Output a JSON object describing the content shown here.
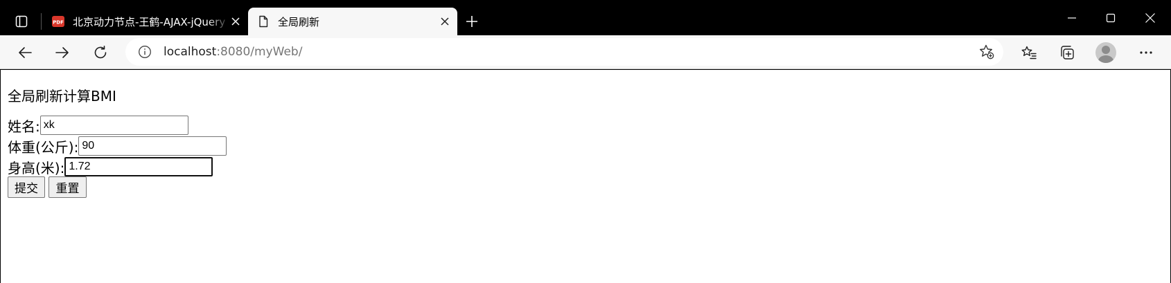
{
  "browser": {
    "tabs": [
      {
        "title": "北京动力节点-王鹤-AJAX-jQuery",
        "icon": "pdf-icon",
        "active": false
      },
      {
        "title": "全局刷新",
        "icon": "page-icon",
        "active": true
      }
    ],
    "address": {
      "host": "localhost",
      "rest": ":8080/myWeb/"
    }
  },
  "page": {
    "heading": "全局刷新计算BMI",
    "form": {
      "name_label": "姓名:",
      "name_value": "xk",
      "weight_label": "体重(公斤):",
      "weight_value": "90",
      "height_label": "身高(米):",
      "height_value": "1.72",
      "submit_label": "提交",
      "reset_label": "重置"
    }
  },
  "colors": {
    "titlebar": "#000000",
    "toolbar": "#f7f7f7",
    "pdf_badge": "#d9372b"
  }
}
